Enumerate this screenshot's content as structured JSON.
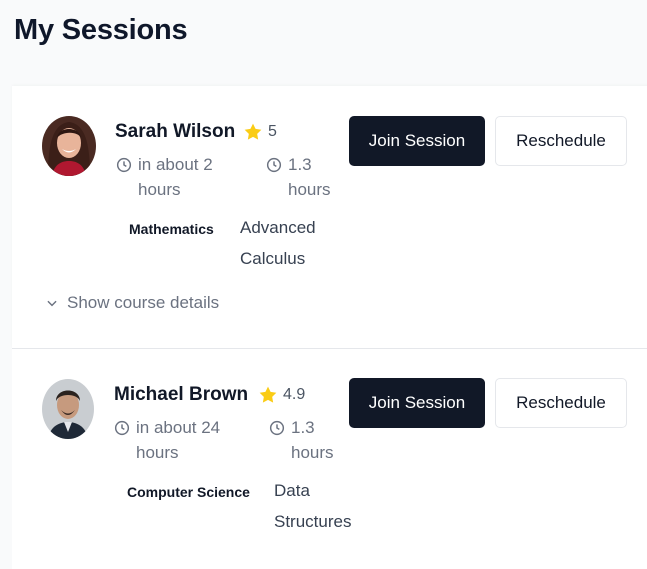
{
  "page": {
    "title": "My Sessions"
  },
  "colors": {
    "primary_button": "#111827",
    "star": "#facc15",
    "muted_text": "#6b7280"
  },
  "sessions": [
    {
      "tutor_name": "Sarah Wilson",
      "rating": "5",
      "start_time": "in about 2 hours",
      "duration": "1.3 hours",
      "subject": "Mathematics",
      "topic": "Advanced Calculus",
      "join_label": "Join Session",
      "reschedule_label": "Reschedule",
      "details_toggle_label": "Show course details"
    },
    {
      "tutor_name": "Michael Brown",
      "rating": "4.9",
      "start_time": "in about 24 hours",
      "duration": "1.3 hours",
      "subject": "Computer Science",
      "topic": "Data Structures",
      "join_label": "Join Session",
      "reschedule_label": "Reschedule"
    }
  ],
  "icons": {
    "rating": "star-icon",
    "time": "clock-icon",
    "toggle": "chevron-down-icon"
  }
}
